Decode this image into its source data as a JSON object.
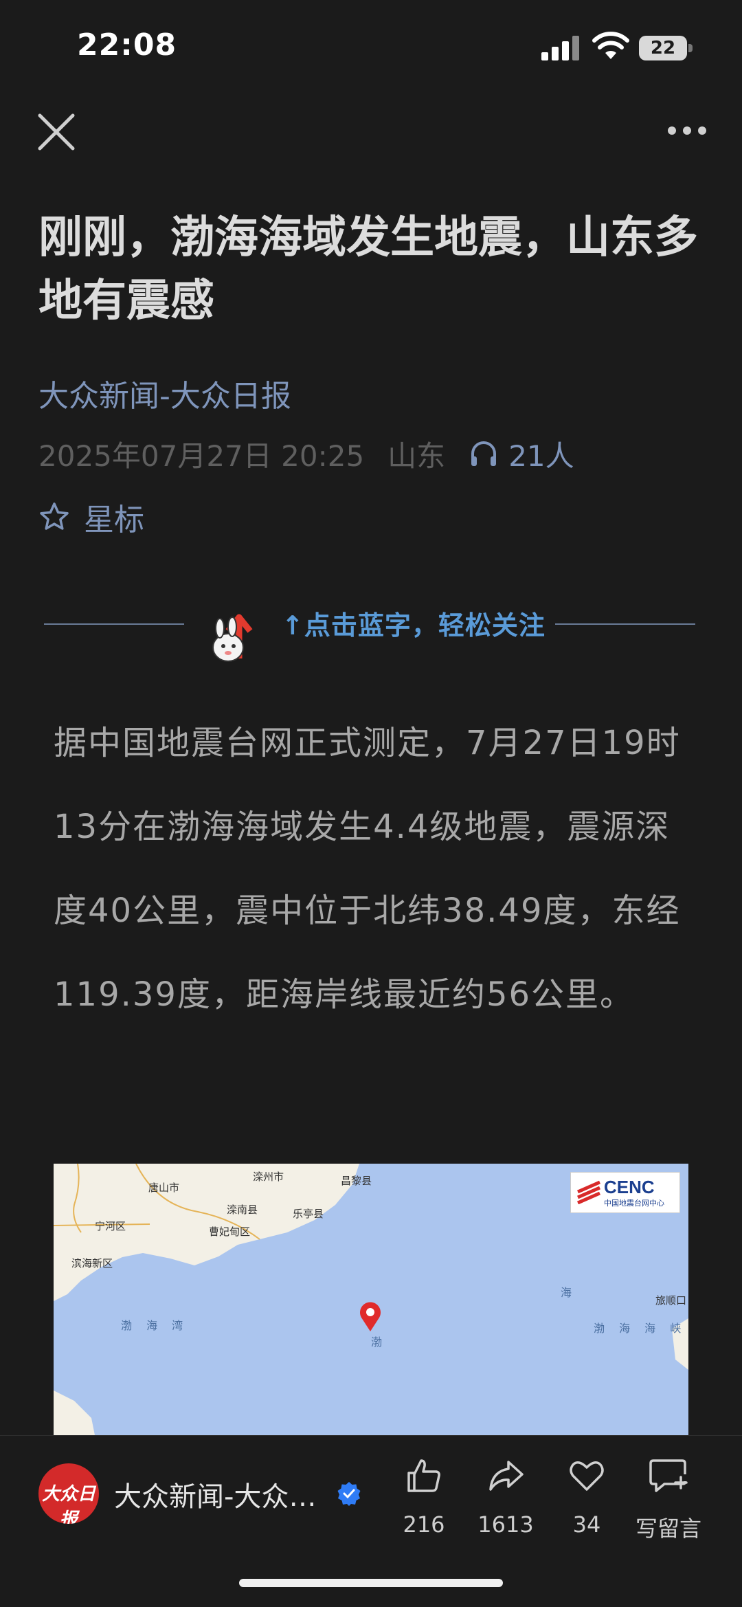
{
  "status_bar": {
    "time": "22:08",
    "battery": "22"
  },
  "article": {
    "title": "刚刚，渤海海域发生地震，山东多地有震感",
    "source": "大众新闻-大众日报",
    "date": "2025年07月27日 20:25",
    "location": "山东",
    "listeners": "21人",
    "star_label": "星标",
    "follow_banner_text": "↑点击蓝字，轻松关注",
    "body": "据中国地震台网正式测定，7月27日19时13分在渤海海域发生4.4级地震，震源深度40公里，震中位于北纬38.49度，东经119.39度，距海岸线最近约56公里。"
  },
  "map": {
    "logo_text": "CENC",
    "logo_subtext": "中国地震台网中心",
    "places": [
      "唐山市",
      "滦州市",
      "昌黎县",
      "滦南县",
      "乐亭县",
      "宁河区",
      "曹妃甸区",
      "滨海新区",
      "旅顺口"
    ],
    "sea_labels": [
      "渤 海 湾",
      "渤 海 海 峡",
      "海",
      "渤"
    ]
  },
  "bottom_bar": {
    "account_name": "大众新闻-大众日报",
    "avatar_text": "大众日报",
    "actions": [
      {
        "icon": "thumbs-up-icon",
        "label": "216"
      },
      {
        "icon": "share-icon",
        "label": "1613"
      },
      {
        "icon": "heart-icon",
        "label": "34"
      },
      {
        "icon": "comment-icon",
        "label": "写留言"
      }
    ]
  },
  "colors": {
    "background": "#1b1b1b",
    "link": "#7f95bb",
    "banner_text": "#5a9bd8",
    "map_sea": "#abc5ee",
    "map_land": "#f3f0e6"
  }
}
